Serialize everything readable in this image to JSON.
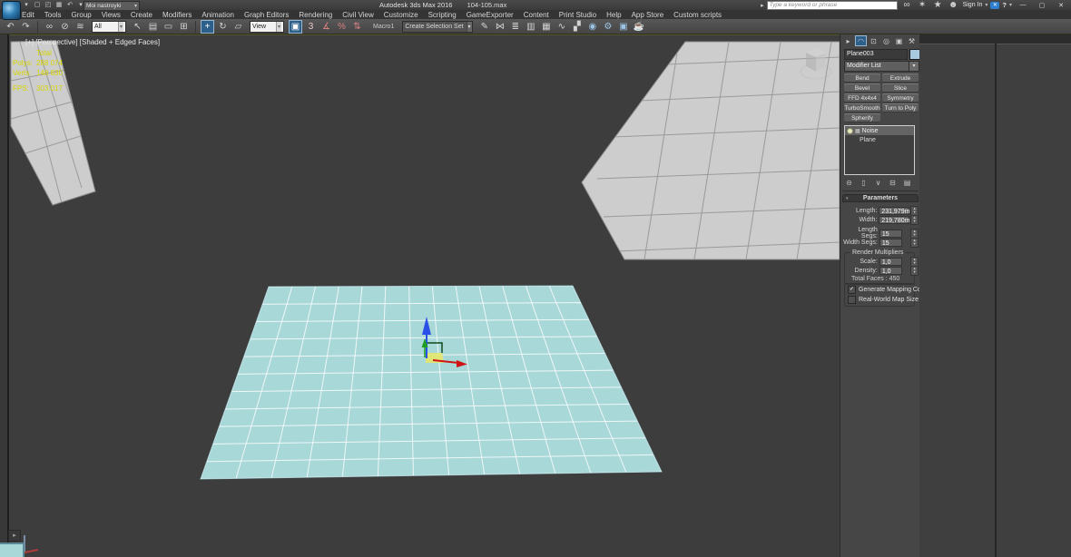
{
  "window": {
    "app_title": "Autodesk 3ds Max 2016",
    "file_name": "104-105.max",
    "workspace": "Moi nastroyki",
    "search_placeholder": "Type a keyword or phrase",
    "sign_in_label": "Sign In"
  },
  "menu": {
    "items": [
      "Edit",
      "Tools",
      "Group",
      "Views",
      "Create",
      "Modifiers",
      "Animation",
      "Graph Editors",
      "Rendering",
      "Civil View",
      "Customize",
      "Scripting",
      "GameExporter",
      "Content",
      "Print Studio",
      "Help",
      "App Store",
      "Custom scripts"
    ]
  },
  "toolbar": {
    "filter_value": "All",
    "coord_system_value": "View",
    "macro_label": "Macro1",
    "selection_set_value": "Create Selection Set"
  },
  "icons": {
    "qat": [
      {
        "name": "app-menu-caret-icon",
        "glyph": "▾"
      },
      {
        "name": "new-scene-icon",
        "glyph": "▢"
      },
      {
        "name": "open-file-icon",
        "glyph": "◰"
      },
      {
        "name": "save-file-icon",
        "glyph": "▦"
      },
      {
        "name": "undo-icon",
        "glyph": "↶"
      },
      {
        "name": "undo-caret-icon",
        "glyph": "▾"
      },
      {
        "name": "redo-icon",
        "glyph": "↷"
      },
      {
        "name": "redo-caret-icon",
        "glyph": "▾"
      },
      {
        "name": "project-folder-icon",
        "glyph": "▣"
      }
    ],
    "infocenter": [
      {
        "name": "infocenter-search-icon",
        "glyph": "∞"
      },
      {
        "name": "subscription-center-icon",
        "glyph": "✶"
      },
      {
        "name": "communication-center-icon",
        "glyph": "★"
      },
      {
        "name": "sign-in-user-icon",
        "glyph": "☻"
      }
    ],
    "toolbar_a": [
      {
        "name": "undo-icon",
        "glyph": "↶"
      },
      {
        "name": "redo-icon",
        "glyph": "↷"
      }
    ],
    "toolbar_b": [
      {
        "name": "select-and-link-icon",
        "glyph": "∞"
      },
      {
        "name": "unlink-selection-icon",
        "glyph": "⊘"
      },
      {
        "name": "bind-to-spacewarp-icon",
        "glyph": "≋"
      }
    ],
    "toolbar_c": [
      {
        "name": "select-object-icon",
        "glyph": "↖"
      },
      {
        "name": "select-by-name-icon",
        "glyph": "▤"
      },
      {
        "name": "rectangular-selection-region-icon",
        "glyph": "▭"
      },
      {
        "name": "window-crossing-icon",
        "glyph": "⊞"
      }
    ],
    "toolbar_d": [
      {
        "name": "select-and-move-icon",
        "glyph": "+",
        "active": true
      },
      {
        "name": "select-and-rotate-icon",
        "glyph": "↻"
      },
      {
        "name": "select-and-scale-icon",
        "glyph": "▱"
      }
    ],
    "toolbar_e": [
      {
        "name": "use-pivot-point-icon",
        "glyph": "▣",
        "active": true
      },
      {
        "name": "snap-toggle-3d-icon",
        "glyph": "3",
        "color": "#e8c8c8"
      },
      {
        "name": "angle-snap-icon",
        "glyph": "∡",
        "color": "#d98080"
      },
      {
        "name": "percent-snap-icon",
        "glyph": "%",
        "color": "#d98080"
      },
      {
        "name": "spinner-snap-icon",
        "glyph": "⇅",
        "color": "#d98080"
      }
    ],
    "toolbar_f": [
      {
        "name": "edit-named-selection-sets-icon",
        "glyph": "✎"
      },
      {
        "name": "mirror-icon",
        "glyph": "⋈"
      },
      {
        "name": "align-icon",
        "glyph": "≣"
      },
      {
        "name": "layer-manager-icon",
        "glyph": "▥"
      },
      {
        "name": "ribbon-icon",
        "glyph": "▦"
      },
      {
        "name": "curve-editor-icon",
        "glyph": "∿"
      },
      {
        "name": "schematic-view-icon",
        "glyph": "▞"
      },
      {
        "name": "material-editor-icon",
        "glyph": "◉",
        "color": "#9cc4e4"
      },
      {
        "name": "render-setup-icon",
        "glyph": "⚙",
        "color": "#9cc4e4"
      },
      {
        "name": "rendered-frame-icon",
        "glyph": "▣",
        "color": "#9cc4e4"
      },
      {
        "name": "render-production-icon",
        "glyph": "☕",
        "color": "#c8d4de"
      }
    ],
    "cp_tabs": [
      {
        "name": "create-tab-icon",
        "glyph": "▸"
      },
      {
        "name": "modify-tab-icon",
        "glyph": "◠",
        "active": true
      },
      {
        "name": "hierarchy-tab-icon",
        "glyph": "⊡"
      },
      {
        "name": "motion-tab-icon",
        "glyph": "◎"
      },
      {
        "name": "display-tab-icon",
        "glyph": "▣"
      },
      {
        "name": "utilities-tab-icon",
        "glyph": "⚒"
      }
    ],
    "stack_tools": [
      {
        "name": "pin-stack-icon",
        "glyph": "⊝"
      },
      {
        "name": "show-end-result-icon",
        "glyph": "▯"
      },
      {
        "name": "make-unique-icon",
        "glyph": "∨"
      },
      {
        "name": "remove-modifier-icon",
        "glyph": "⊟"
      },
      {
        "name": "configure-modifier-sets-icon",
        "glyph": "▤"
      }
    ]
  },
  "viewport": {
    "label": "[+] [Perspective] [Shaded + Edged Faces]",
    "stats": {
      "total_header": "Total",
      "polys_label": "Polys:",
      "polys_value": "288 074",
      "verts_label": "Verts:",
      "verts_value": "148 830",
      "fps_label": "FPS:",
      "fps_value": "303.017"
    }
  },
  "command_panel": {
    "object_name": "Plane003",
    "modifier_list_label": "Modifier List",
    "modifier_buttons": [
      "Bend",
      "Extrude",
      "Bevel",
      "Slice",
      "FFD 4x4x4",
      "Symmetry",
      "TurboSmooth",
      "Turn to Poly",
      "Spherify"
    ],
    "stack_items": [
      {
        "label": "Noise"
      },
      {
        "label": "Plane"
      }
    ],
    "parameters": {
      "title": "Parameters",
      "length_label": "Length:",
      "length_value": "231,979m",
      "width_label": "Width:",
      "width_value": "219,780m",
      "length_segs_label": "Length Segs:",
      "length_segs_value": "15",
      "width_segs_label": "Width Segs:",
      "width_segs_value": "15",
      "render_multipliers_title": "Render Multipliers",
      "scale_label": "Scale:",
      "scale_value": "1,0",
      "density_label": "Density:",
      "density_value": "1,0",
      "total_faces_text": "Total Faces : 450",
      "generate_mapping_label": "Generate Mapping Coords.",
      "real_world_label": "Real-World Map Size"
    }
  },
  "colors": {
    "plane_fill": "#a9d8d9",
    "stats_text": "#d6d600",
    "active_tool_bg": "#2d5f8b",
    "gizmo_x": "#d01414",
    "gizmo_y": "#1f9e1f",
    "gizmo_z": "#2b50e8",
    "object_color_swatch": "#a9cbe2"
  }
}
